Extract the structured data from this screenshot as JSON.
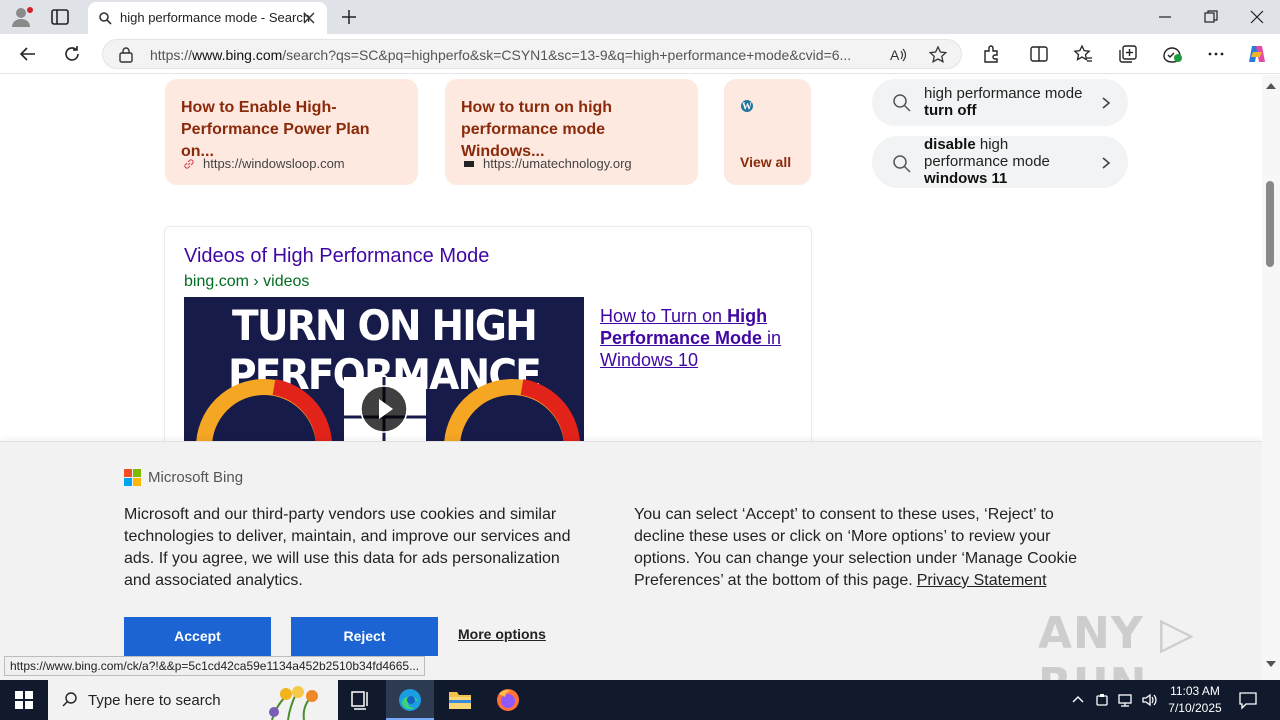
{
  "browser": {
    "tab_title": "high performance mode - Search",
    "url_prefix": "https://",
    "url_domain": "www.bing.com",
    "url_rest": "/search?qs=SC&pq=highperfo&sk=CSYN1&sc=13-9&q=high+performance+mode&cvid=6..."
  },
  "results": {
    "cards": [
      {
        "title": "How to Enable High-Performance Power Plan on...",
        "source": "https://windowsloop.com"
      },
      {
        "title": "How to turn on high performance mode Windows...",
        "source": "https://umatechnology.org"
      }
    ],
    "view_all": "View all"
  },
  "related": [
    {
      "prefix": "high performance mode ",
      "bold": "turn off"
    },
    {
      "bold_pre": "disable",
      "middle": " high performance mode ",
      "bold": "windows 11"
    }
  ],
  "videos": {
    "title": "Videos of High Performance Mode",
    "subtitle": "bing.com › videos",
    "thumb_text": "TURN ON HIGH PERFORMANCE",
    "link_pre": "How to Turn on ",
    "link_bold": "High Performance Mode",
    "link_post": " in Windows 10"
  },
  "cookie": {
    "brand": "Microsoft Bing",
    "left_text": "Microsoft and our third-party vendors use cookies and similar technologies to deliver, maintain, and improve our services and ads. If you agree, we will use this data for ads personalization and associated analytics.",
    "right_text": "You can select ‘Accept’ to consent to these uses, ‘Reject’ to decline these uses or click on ‘More options’ to review your options. You can change your selection under ‘Manage Cookie Preferences’ at the bottom of this page.",
    "privacy_link": "Privacy Statement",
    "accept": "Accept",
    "reject": "Reject",
    "more_options": "More options"
  },
  "status_url": "https://www.bing.com/ck/a?!&&p=5c1cd42ca59e1134a452b2510b34fd4665...",
  "watermark": "ANY ▷ RUN",
  "taskbar": {
    "search_placeholder": "Type here to search",
    "time": "11:03 AM",
    "date": "7/10/2025"
  },
  "colors": {
    "accent_blue": "#1c64d4",
    "card_bg": "#fde9e0",
    "card_title": "#8a2a0b",
    "link_purple": "#4007a2",
    "url_green": "#006d21"
  }
}
